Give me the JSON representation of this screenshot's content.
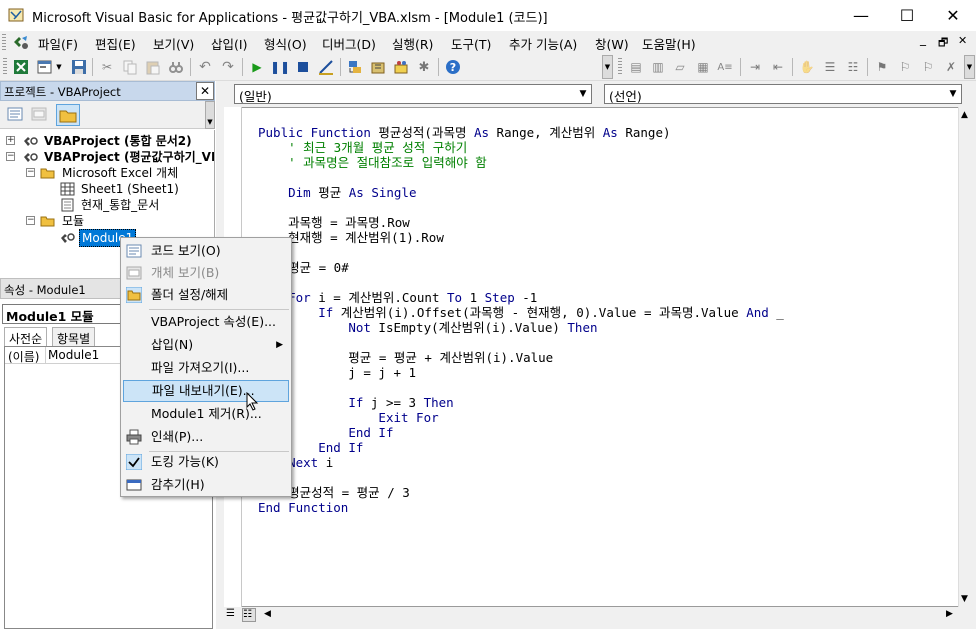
{
  "window": {
    "title": "Microsoft Visual Basic for Applications - 평균값구하기_VBA.xlsm - [Module1 (코드)]",
    "minimize_glyph": "—",
    "maximize_glyph": "☐",
    "close_glyph": "✕"
  },
  "menubar": {
    "items": [
      "파일(F)",
      "편집(E)",
      "보기(V)",
      "삽입(I)",
      "형식(O)",
      "디버그(D)",
      "실행(R)",
      "도구(T)",
      "추가 기능(A)",
      "창(W)",
      "도움말(H)"
    ],
    "doc_minimize": "_",
    "doc_restore": "🗗",
    "doc_close": "✕"
  },
  "project_pane": {
    "title": "프로젝트 - VBAProject",
    "close_glyph": "✕",
    "tree": [
      {
        "label": "VBAProject (통합 문서2)",
        "bold": true
      },
      {
        "label": "VBAProject (평균값구하기_VB",
        "bold": true
      },
      {
        "label": "Microsoft Excel 개체"
      },
      {
        "label": "Sheet1 (Sheet1)"
      },
      {
        "label": "현재_통합_문서"
      },
      {
        "label": "모듈"
      },
      {
        "label": "Module1"
      }
    ]
  },
  "properties_pane": {
    "title": "속성 - Module1",
    "selector": "Module1 모듈",
    "tabs": [
      "사전순",
      "항목별"
    ],
    "row_name": "(이름)",
    "row_value": "Module1"
  },
  "code_window": {
    "object_combo": "(일반)",
    "proc_combo": "(선언)",
    "lines": [
      [
        {
          "t": "Public Function",
          "c": "kw"
        },
        {
          "t": " 평균성적(과목명 "
        },
        {
          "t": "As",
          "c": "kw"
        },
        {
          "t": " Range, 계산범위 "
        },
        {
          "t": "As",
          "c": "kw"
        },
        {
          "t": " Range)"
        }
      ],
      [
        {
          "t": "    ' 최근 3개월 평균 성적 구하기",
          "c": "cm"
        }
      ],
      [
        {
          "t": "    ' 과목명은 절대참조로 입력해야 함",
          "c": "cm"
        }
      ],
      [],
      [
        {
          "t": "    "
        },
        {
          "t": "Dim",
          "c": "kw"
        },
        {
          "t": " 평균 "
        },
        {
          "t": "As Single",
          "c": "kw"
        }
      ],
      [],
      [
        {
          "t": "    과목행 = 과목명.Row"
        }
      ],
      [
        {
          "t": "    현재행 = 계산범위(1).Row"
        }
      ],
      [],
      [
        {
          "t": "    평균 = 0#"
        }
      ],
      [],
      [
        {
          "t": "    "
        },
        {
          "t": "For",
          "c": "kw"
        },
        {
          "t": " i = 계산범위.Count "
        },
        {
          "t": "To",
          "c": "kw"
        },
        {
          "t": " 1 "
        },
        {
          "t": "Step",
          "c": "kw"
        },
        {
          "t": " -1"
        }
      ],
      [
        {
          "t": "        "
        },
        {
          "t": "If",
          "c": "kw"
        },
        {
          "t": " 계산범위(i).Offset(과목행 - 현재행, 0).Value = 과목명.Value "
        },
        {
          "t": "And",
          "c": "kw"
        },
        {
          "t": " _"
        }
      ],
      [
        {
          "t": "            "
        },
        {
          "t": "Not",
          "c": "kw"
        },
        {
          "t": " IsEmpty(계산범위(i).Value) "
        },
        {
          "t": "Then",
          "c": "kw"
        }
      ],
      [],
      [
        {
          "t": "            평균 = 평균 + 계산범위(i).Value"
        }
      ],
      [
        {
          "t": "            j = j + 1"
        }
      ],
      [],
      [
        {
          "t": "            "
        },
        {
          "t": "If",
          "c": "kw"
        },
        {
          "t": " j >= 3 "
        },
        {
          "t": "Then",
          "c": "kw"
        }
      ],
      [
        {
          "t": "                "
        },
        {
          "t": "Exit For",
          "c": "kw"
        }
      ],
      [
        {
          "t": "            "
        },
        {
          "t": "End If",
          "c": "kw"
        }
      ],
      [
        {
          "t": "        "
        },
        {
          "t": "End If",
          "c": "kw"
        }
      ],
      [
        {
          "t": "    "
        },
        {
          "t": "Next",
          "c": "kw"
        },
        {
          "t": " i"
        }
      ],
      [],
      [
        {
          "t": "    평균성적 = 평균 / 3"
        }
      ],
      [
        {
          "t": "End Function",
          "c": "kw"
        }
      ]
    ]
  },
  "context_menu": {
    "items": [
      {
        "label": "코드 보기(O)",
        "icon": "code-view-icon"
      },
      {
        "label": "개체 보기(B)",
        "icon": "object-view-icon",
        "disabled": true
      },
      {
        "label": "폴더 설정/해제",
        "icon": "folder-toggle-icon"
      },
      {
        "sep": true
      },
      {
        "label": "VBAProject 속성(E)..."
      },
      {
        "label": "삽입(N)",
        "submenu": true
      },
      {
        "label": "파일 가져오기(I)..."
      },
      {
        "label": "파일 내보내기(E)...",
        "highlighted": true
      },
      {
        "label": "Module1 제거(R)..."
      },
      {
        "label": "인쇄(P)...",
        "icon": "print-icon"
      },
      {
        "sep": true
      },
      {
        "label": "도킹 가능(K)",
        "icon": "checkmark-icon"
      },
      {
        "label": "감추기(H)",
        "icon": "hide-icon"
      }
    ]
  },
  "colors": {
    "keyword": "#00008b",
    "comment": "#008000",
    "selection": "#0078d7",
    "menu_highlight": "#cce4f7"
  }
}
